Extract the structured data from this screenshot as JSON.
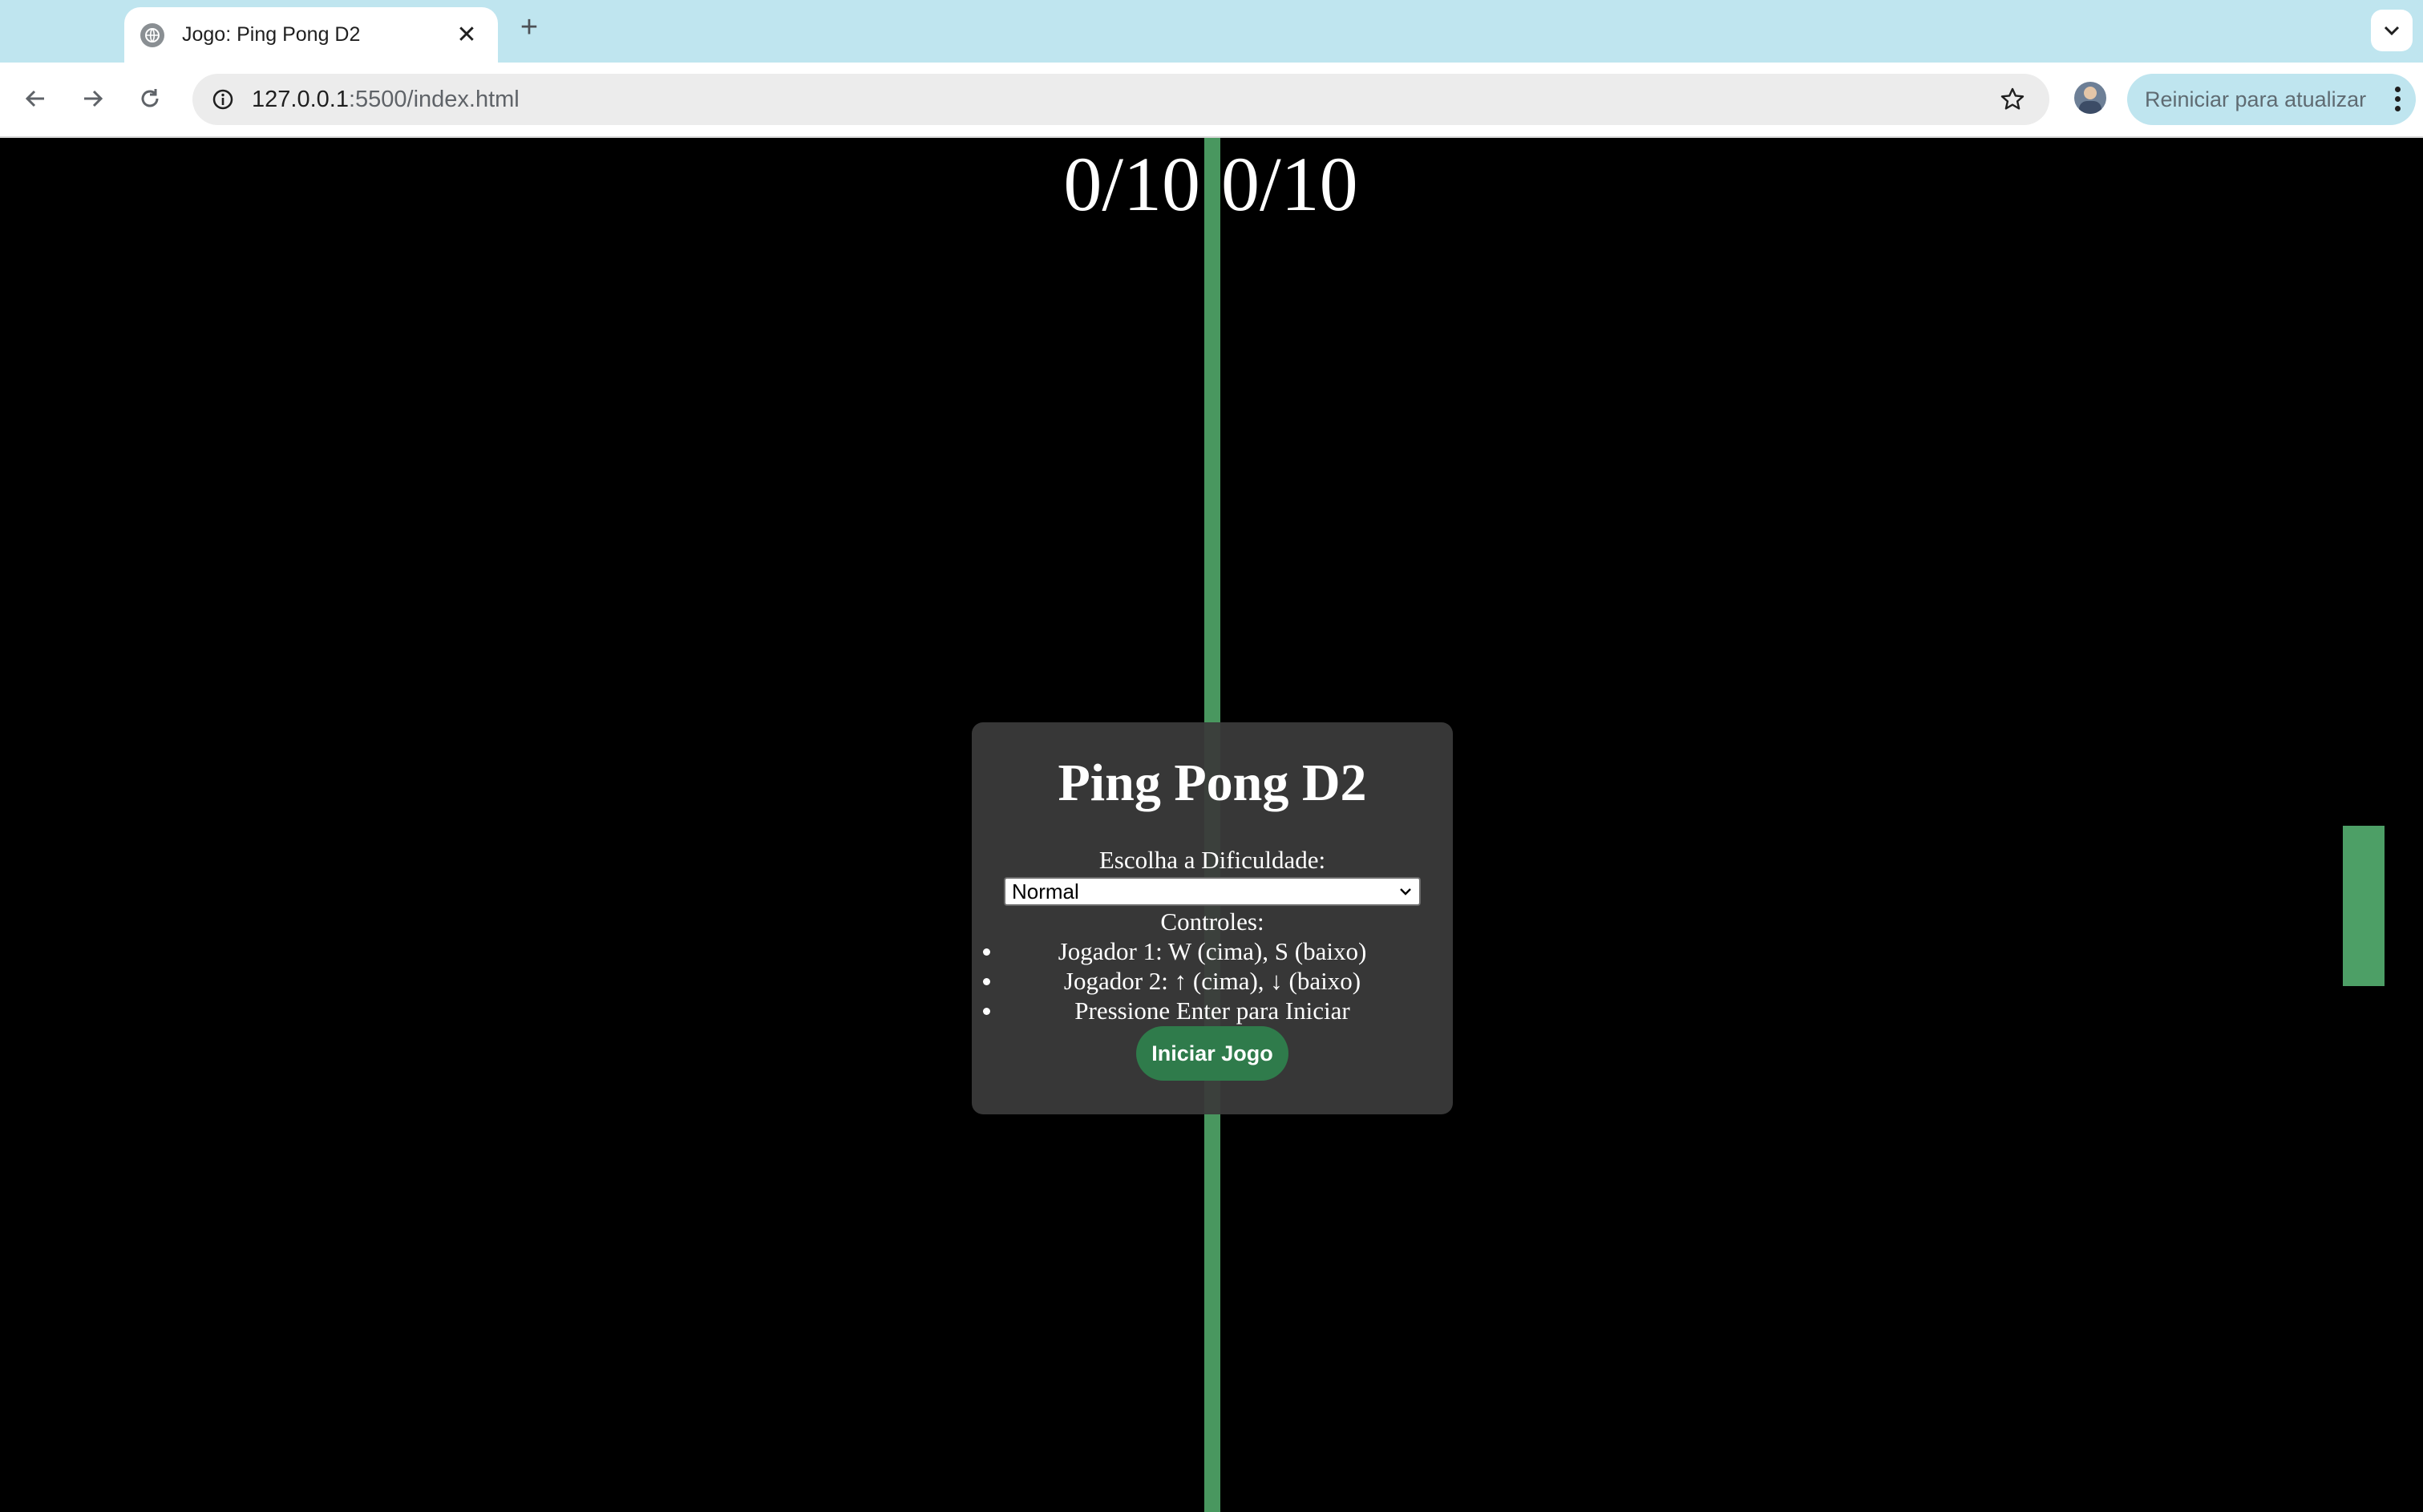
{
  "browser": {
    "tab_title": "Jogo: Ping Pong D2",
    "tab_close_glyph": "✕",
    "new_tab_glyph": "+",
    "url_host": "127.0.0.1",
    "url_path": ":5500/index.html",
    "update_button_label": "Reiniciar para atualizar",
    "icons": [
      "globe-icon",
      "close-icon",
      "plus-icon",
      "chevron-down-icon",
      "back-arrow-icon",
      "forward-arrow-icon",
      "reload-icon",
      "site-info-icon",
      "bookmark-star-icon",
      "avatar",
      "more-vert-icon"
    ]
  },
  "game": {
    "score_left": "0/10",
    "score_right": "0/10",
    "colors": {
      "background": "#000000",
      "center_line": "#49975f",
      "paddle": "#4d9f66",
      "start_button": "#2f7b4b",
      "menu_panel": "#3a3a3a"
    }
  },
  "menu": {
    "title": "Ping Pong D2",
    "difficulty_label": "Escolha a Dificuldade:",
    "difficulty_selected": "Normal",
    "controls_label": "Controles:",
    "controls": [
      "Jogador 1: W (cima), S (baixo)",
      "Jogador 2: ↑ (cima), ↓ (baixo)",
      "Pressione Enter para Iniciar"
    ],
    "start_button_label": "Iniciar Jogo"
  }
}
